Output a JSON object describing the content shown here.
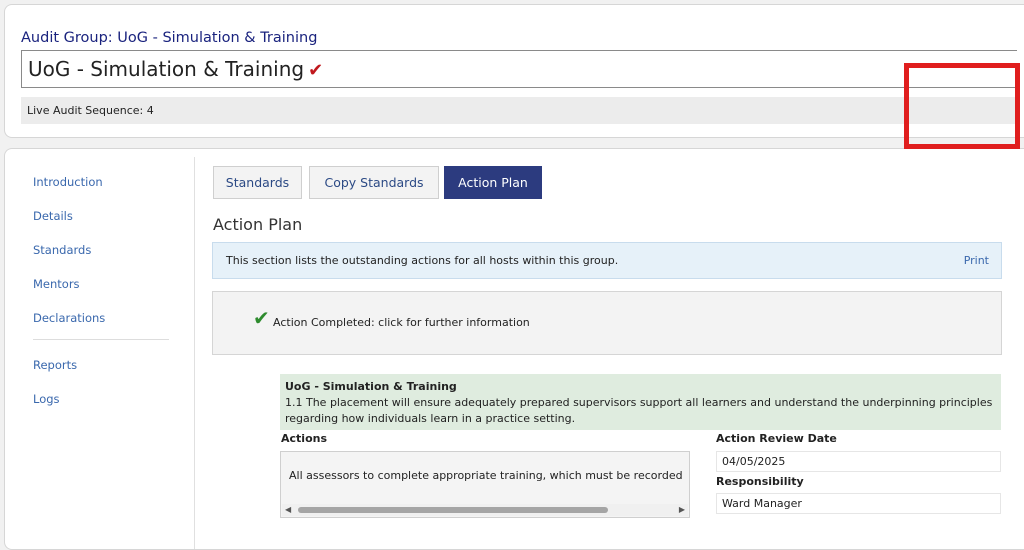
{
  "header": {
    "audit_group_label": "Audit Group: UoG - Simulation & Training",
    "title": "UoG - Simulation & Training",
    "title_check": "✔",
    "sequence": "Live Audit Sequence: 4"
  },
  "sidebar": {
    "items": [
      {
        "label": "Introduction"
      },
      {
        "label": "Details"
      },
      {
        "label": "Standards"
      },
      {
        "label": "Mentors"
      },
      {
        "label": "Declarations"
      }
    ],
    "items2": [
      {
        "label": "Reports"
      },
      {
        "label": "Logs"
      }
    ]
  },
  "tabs": [
    {
      "label": "Standards",
      "active": false
    },
    {
      "label": "Copy Standards",
      "active": false
    },
    {
      "label": "Action Plan",
      "active": true
    }
  ],
  "section": {
    "title": "Action Plan",
    "info": "This section lists the outstanding actions for all hosts within this group.",
    "print": "Print"
  },
  "legend": {
    "icon": "green-check-icon",
    "text": "Action Completed: click for further information"
  },
  "standard": {
    "name": "UoG - Simulation & Training",
    "description": "1.1 The placement will ensure adequately prepared supervisors support all learners and understand the underpinning principles regarding how individuals learn in a practice setting.",
    "actions_header": "Actions",
    "action_text": "All assessors to complete appropriate training, which must be recorded",
    "review_date_header": "Action Review Date",
    "review_date": "04/05/2025",
    "responsibility_header": "Responsibility",
    "responsibility": "Ward Manager"
  },
  "colors": {
    "accent": "#2c3b7f",
    "link": "#3a68ad",
    "highlight": "#e01e1e",
    "complete": "#2e8b2e"
  }
}
